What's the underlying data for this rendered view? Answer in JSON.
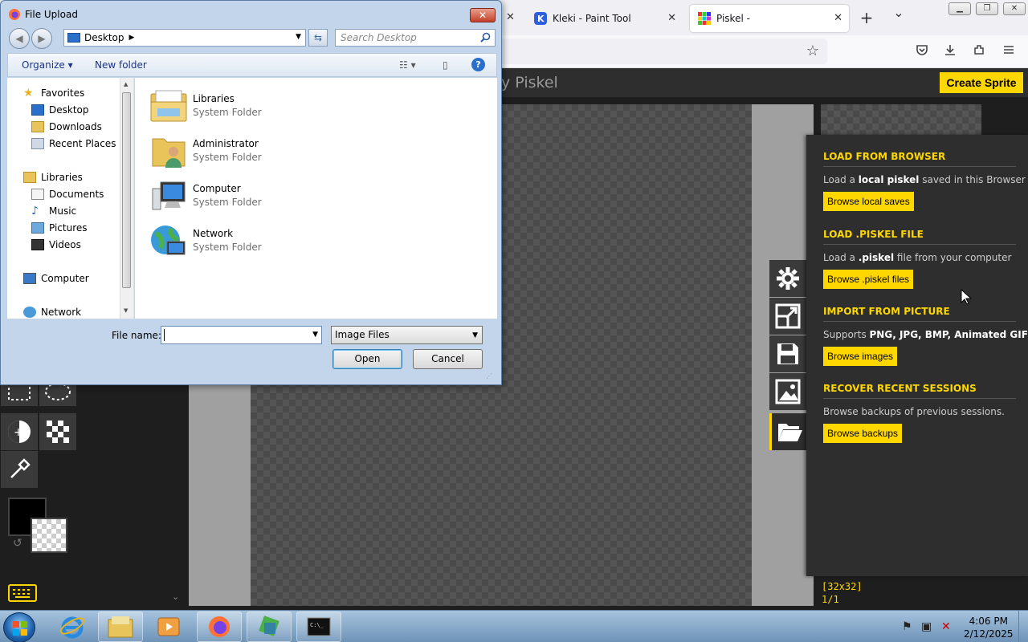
{
  "browser": {
    "tabs": [
      {
        "label": "Kleki - Paint Tool"
      },
      {
        "label": "Piskel -"
      }
    ],
    "new_tab": "+",
    "list_tabs": "⌄",
    "close_glyph": "✕"
  },
  "piskel": {
    "title": "y Piskel",
    "create_sprite": "Create Sprite",
    "import_panel": {
      "sections": [
        {
          "heading": "LOAD FROM BROWSER",
          "desc_pre": "Load a ",
          "desc_bold": "local piskel",
          "desc_post": " saved in this Browser",
          "button": "Browse local saves"
        },
        {
          "heading": "LOAD .PISKEL FILE",
          "desc_pre": "Load a ",
          "desc_bold": ".piskel",
          "desc_post": " file from your computer",
          "button": "Browse .piskel files"
        },
        {
          "heading": "IMPORT FROM PICTURE",
          "desc_pre": "Supports ",
          "desc_bold": "PNG, JPG, BMP, Animated GIF",
          "desc_post": "",
          "button": "Browse images"
        },
        {
          "heading": "RECOVER RECENT SESSIONS",
          "desc_pre": "Browse backups of previous sessions.",
          "desc_bold": "",
          "desc_post": "",
          "button": "Browse backups"
        }
      ]
    },
    "status": {
      "size": "[32x32]",
      "frame": "1/1"
    },
    "accent_color": "#ffd700"
  },
  "dialog": {
    "title": "File Upload",
    "address": "Desktop",
    "search_placeholder": "Search Desktop",
    "toolbar": {
      "organize": "Organize",
      "new_folder": "New folder"
    },
    "nav": {
      "favorites": "Favorites",
      "desktop": "Desktop",
      "downloads": "Downloads",
      "recent": "Recent Places",
      "libraries": "Libraries",
      "documents": "Documents",
      "music": "Music",
      "pictures": "Pictures",
      "videos": "Videos",
      "computer": "Computer",
      "network": "Network"
    },
    "files": [
      {
        "name": "Libraries",
        "type": "System Folder"
      },
      {
        "name": "Administrator",
        "type": "System Folder"
      },
      {
        "name": "Computer",
        "type": "System Folder"
      },
      {
        "name": "Network",
        "type": "System Folder"
      }
    ],
    "file_name_label": "File name:",
    "file_name_value": "",
    "file_type": "Image Files",
    "open": "Open",
    "cancel": "Cancel"
  },
  "taskbar": {
    "time": "4:06 PM",
    "date": "2/12/2025"
  }
}
